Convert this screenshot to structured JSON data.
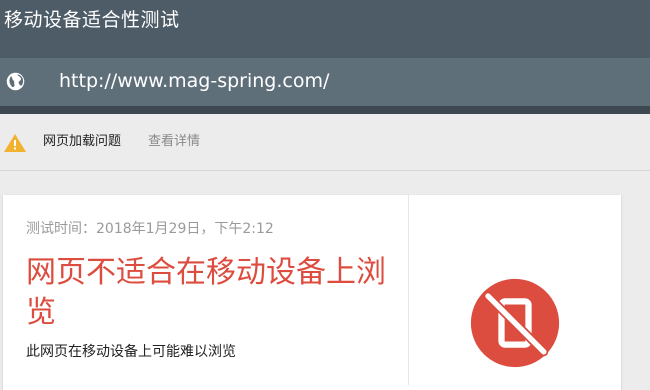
{
  "header": {
    "title": "移动设备适合性测试"
  },
  "url_bar": {
    "icon": "globe-icon",
    "url": "http://www.mag-spring.com/"
  },
  "issues": {
    "icon": "warning-icon",
    "label": "网页加载问题",
    "link": "查看详情"
  },
  "result": {
    "test_time": "测试时间：2018年1月29日，下午2:12",
    "title": "网页不适合在移动设备上浏览",
    "description": "此网页在移动设备上可能难以浏览",
    "icon": "not-mobile-friendly-icon",
    "accent_color": "#dc4c3f"
  },
  "colors": {
    "header_bg": "#4e5c67",
    "url_bar_bg": "#5f6f7a",
    "warning": "#f2b12e",
    "error": "#dc4c3f"
  }
}
